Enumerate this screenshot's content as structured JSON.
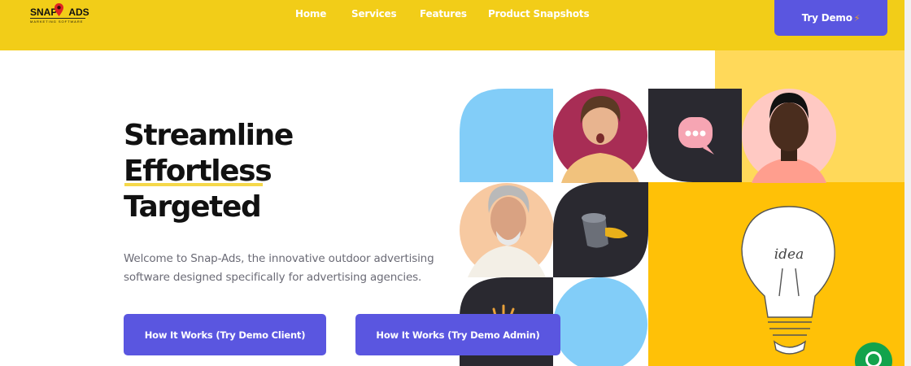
{
  "brand": {
    "logo_text_left": "SNAP",
    "logo_text_right": "ADS",
    "logo_tagline": "MARKETING SOFTWARE"
  },
  "nav": {
    "items": [
      {
        "label": "Home"
      },
      {
        "label": "Services"
      },
      {
        "label": "Features"
      },
      {
        "label": "Product Snapshots"
      }
    ],
    "cta_label": "Try Demo",
    "cta_icon": "bolt-icon"
  },
  "hero": {
    "headline": [
      "Streamline",
      "Effortless",
      "Targeted"
    ],
    "subtext_lines": [
      "Welcome to Snap-Ads, the innovative outdoor advertising",
      "software designed specifically for advertising agencies."
    ],
    "buttons": [
      {
        "label": "How It Works (Try Demo Client)"
      },
      {
        "label": "How It Works (Try Demo Admin)"
      }
    ]
  },
  "mosaic": {
    "lightbulb_text": "idea"
  },
  "colors": {
    "header_bg": "#f2cd18",
    "accent": "#5a56e0",
    "dark_tile": "#2a2930",
    "sky_tile": "#82cdf8",
    "chat_green": "#12a34c",
    "highlight": "#f5d84a"
  }
}
